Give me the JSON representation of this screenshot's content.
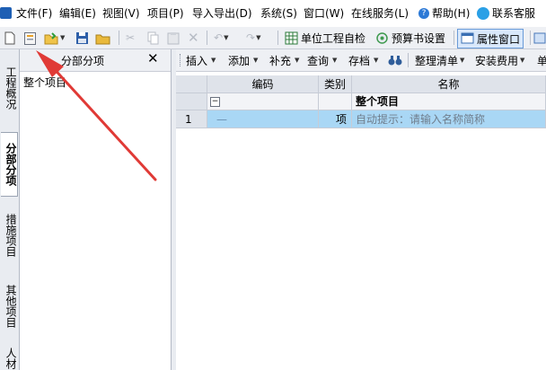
{
  "menu": {
    "items": [
      "文件(F)",
      "编辑(E)",
      "视图(V)",
      "项目(P)",
      "导入导出(D)",
      "系统(S)",
      "窗口(W)",
      "在线服务(L)",
      "帮助(H)",
      "联系客服"
    ]
  },
  "toolbar": {
    "unit_check_label": "单位工程自检",
    "budget_settings_label": "预算书设置",
    "property_window_label": "属性窗口"
  },
  "left_tabs": [
    "工程概况",
    "分部分项",
    "措施项目",
    "其他项目",
    "人材"
  ],
  "left_panel": {
    "title": "分部分项",
    "close_symbol": "✕",
    "tree_root": "整个项目"
  },
  "grid_toolbar": {
    "items": [
      "插入",
      "添加",
      "补充",
      "查询",
      "存档",
      "整理清单",
      "安装费用",
      "单"
    ]
  },
  "grid": {
    "headers": {
      "code": "编码",
      "type": "类别",
      "name": "名称"
    },
    "group_row": {
      "toggle": "−",
      "name": "整个项目"
    },
    "rows": [
      {
        "index": "1",
        "code": "—",
        "type": "项",
        "name": "自动提示：请输入名称简称"
      }
    ]
  },
  "colors": {
    "selected_row": "#a9d7f5",
    "annotation_arrow": "#e03a36"
  }
}
